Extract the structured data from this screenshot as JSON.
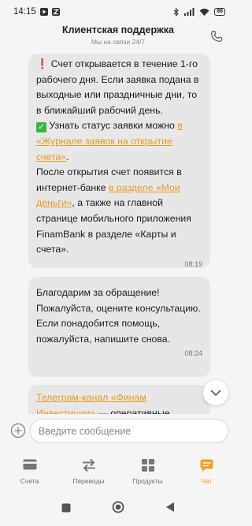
{
  "status_bar": {
    "time": "14:15",
    "battery": "86"
  },
  "header": {
    "title": "Клиентская поддержка",
    "subtitle": "Мы на связи 24/7"
  },
  "messages": [
    {
      "p1": "Счет открывается в течение 1-го рабочего дня. Если заявка подана в выходные или праздничные дни, то в ближайший рабочий день.",
      "p2_text": "Узнать статус заявки можно ",
      "p2_link": "в «Журнале заявок на открытие счета»",
      "p2_end": ".",
      "p3_text": "После открытия счет появится в интернет-банке ",
      "p3_link": "в разделе «Мои деньги»",
      "p3_end": ", а также на главной странице мобильного приложения FinamBank в разделе «Карты и счета».",
      "time": "08:19"
    },
    {
      "text_lines": [
        "Благодарим за обращение!",
        "Пожалуйста, оцените консультацию.",
        "Если понадобится помощь, пожалуйста, напишите снова."
      ],
      "time": "08:24"
    },
    {
      "link": "Телеграм-канал «Финам Инвестиции»",
      "text": " — оперативные"
    }
  ],
  "input": {
    "placeholder": "Введите сообщение"
  },
  "tabs": [
    {
      "label": "Счета",
      "icon": "card-icon"
    },
    {
      "label": "Переводы",
      "icon": "transfer-icon"
    },
    {
      "label": "Продукты",
      "icon": "grid-icon"
    },
    {
      "label": "Чат",
      "icon": "chat-icon",
      "active": true
    }
  ],
  "colors": {
    "accent": "#f0a028",
    "bubble": "#e7e7e7",
    "link": "#e59a23"
  }
}
